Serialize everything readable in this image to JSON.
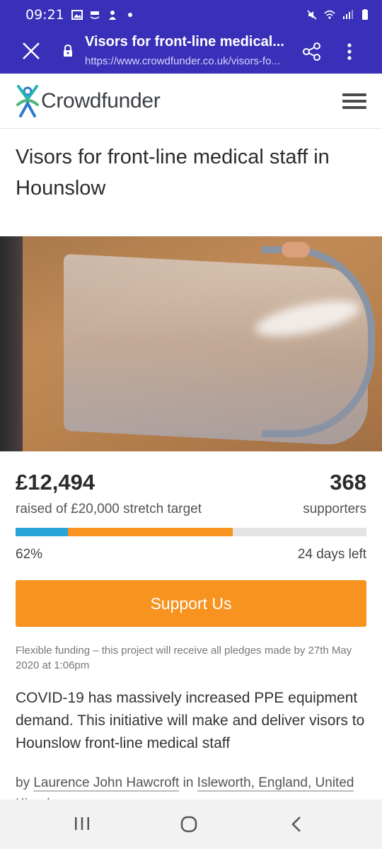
{
  "status_bar": {
    "time": "09:21",
    "notification_icons": [
      "gallery-icon",
      "amazon-icon",
      "alert-app-icon",
      "dot-icon"
    ],
    "right_icons": [
      "mute-icon",
      "wifi-icon",
      "signal-icon",
      "battery-icon"
    ]
  },
  "browser_tab": {
    "title": "Visors for front-line medical...",
    "url": "https://www.crowdfunder.co.uk/visors-fo...",
    "background": "#3a2fb8"
  },
  "site": {
    "brand": "Crowdfunder",
    "brand_colors": {
      "teal": "#22b5b5",
      "blue": "#2a7bd0",
      "green": "#4cb87a"
    }
  },
  "project": {
    "title": "Visors for front-line medical staff in Hounslow",
    "image_alt": "Clear plastic face visor with grey frame"
  },
  "funding": {
    "amount": "£12,494",
    "raised_text": "raised of £20,000 stretch target",
    "supporters_count": "368",
    "supporters_label": "supporters",
    "percent": "62%",
    "days_left": "24 days left",
    "progress": {
      "blue_fraction": 0.15,
      "orange_end_fraction": 0.62
    },
    "colors": {
      "blue": "#2aa5d8",
      "orange": "#f7931e",
      "track": "#e4e4e4"
    }
  },
  "cta": {
    "label": "Support Us",
    "color": "#f7931e"
  },
  "flexible_note": "Flexible funding – this project will receive all pledges made by 27th May 2020 at 1:06pm",
  "description": "COVID-19 has massively increased PPE equipment demand. This initiative will make and deliver visors to Hounslow front-line medical staff",
  "byline": {
    "prefix": "by",
    "author": "Laurence John Hawcroft",
    "in_word": "in",
    "location": "Isleworth, England, United Kingdom"
  },
  "nav_bar": {
    "buttons": [
      "recent-apps-icon",
      "home-icon",
      "back-icon"
    ]
  }
}
